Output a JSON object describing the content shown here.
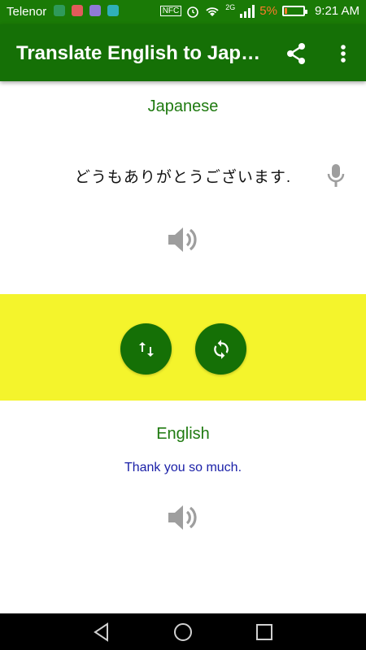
{
  "status_bar": {
    "carrier": "Telenor",
    "network": "2G",
    "battery": "5%",
    "time": "9:21 AM"
  },
  "app_bar": {
    "title": "Translate English to Japa..."
  },
  "source": {
    "language": "Japanese",
    "text": "どうもありがとうございます."
  },
  "target": {
    "language": "English",
    "text": "Thank you so much."
  },
  "colors": {
    "primary": "#157006",
    "band": "#f4f42c",
    "label": "#1f7a10",
    "translation": "#1b21a8"
  }
}
